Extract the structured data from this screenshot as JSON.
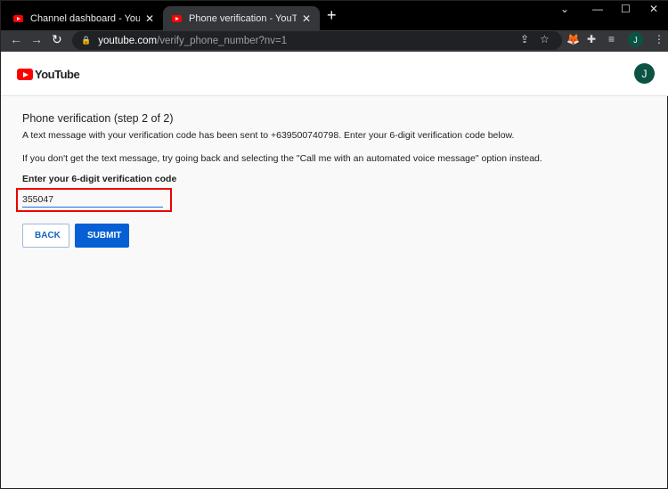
{
  "browser": {
    "tabs": [
      {
        "title": "Channel dashboard - YouTube Studio",
        "active": false
      },
      {
        "title": "Phone verification - YouTube",
        "active": true
      }
    ],
    "url_host": "youtube.com",
    "url_path": "/verify_phone_number?nv=1",
    "profile_initial": "J"
  },
  "header": {
    "logo_text": "YouTube",
    "avatar_initial": "J"
  },
  "page": {
    "title": "Phone verification (step 2 of 2)",
    "message": "A text message with your verification code has been sent to +639500740798. Enter your 6-digit verification code below.",
    "hint": "If you don't get the text message, try going back and selecting the \"Call me with an automated voice message\" option instead.",
    "code_label": "Enter your 6-digit verification code",
    "code_value": "355047",
    "back_label": "BACK",
    "submit_label": "SUBMIT"
  }
}
